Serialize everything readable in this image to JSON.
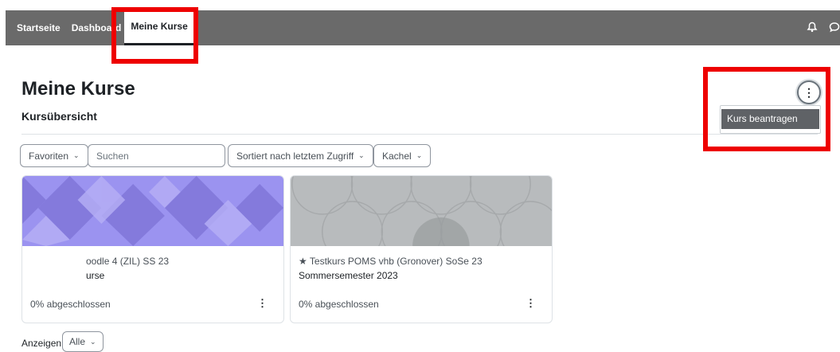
{
  "nav": {
    "items": [
      "Startseite",
      "Dashboard"
    ],
    "active": "Meine Kurse",
    "icons": [
      "bell-icon",
      "chat-icon"
    ]
  },
  "page": {
    "title": "Meine Kurse",
    "section": "Kursübersicht"
  },
  "menu": {
    "toggle_icon": "kebab-icon",
    "item": "Kurs beantragen"
  },
  "filters": {
    "favorites": "Favoriten",
    "search_placeholder": "Suchen",
    "sort": "Sortiert nach letztem Zugriff",
    "view": "Kachel"
  },
  "courses": [
    {
      "title": "oodle 4 (ZIL) SS 23",
      "subtitle": "urse",
      "progress": "0% abgeschlossen",
      "starred": false,
      "image_color": "#9b93f0"
    },
    {
      "star_icon": "★",
      "title": "Testkurs POMS vhb (Gronover) SoSe 23",
      "subtitle": "Sommersemester 2023",
      "progress": "0% abgeschlossen",
      "starred": true,
      "image_color": "#b8bbbd"
    }
  ],
  "footer": {
    "show_label": "Anzeigen",
    "show_value": "Alle"
  }
}
